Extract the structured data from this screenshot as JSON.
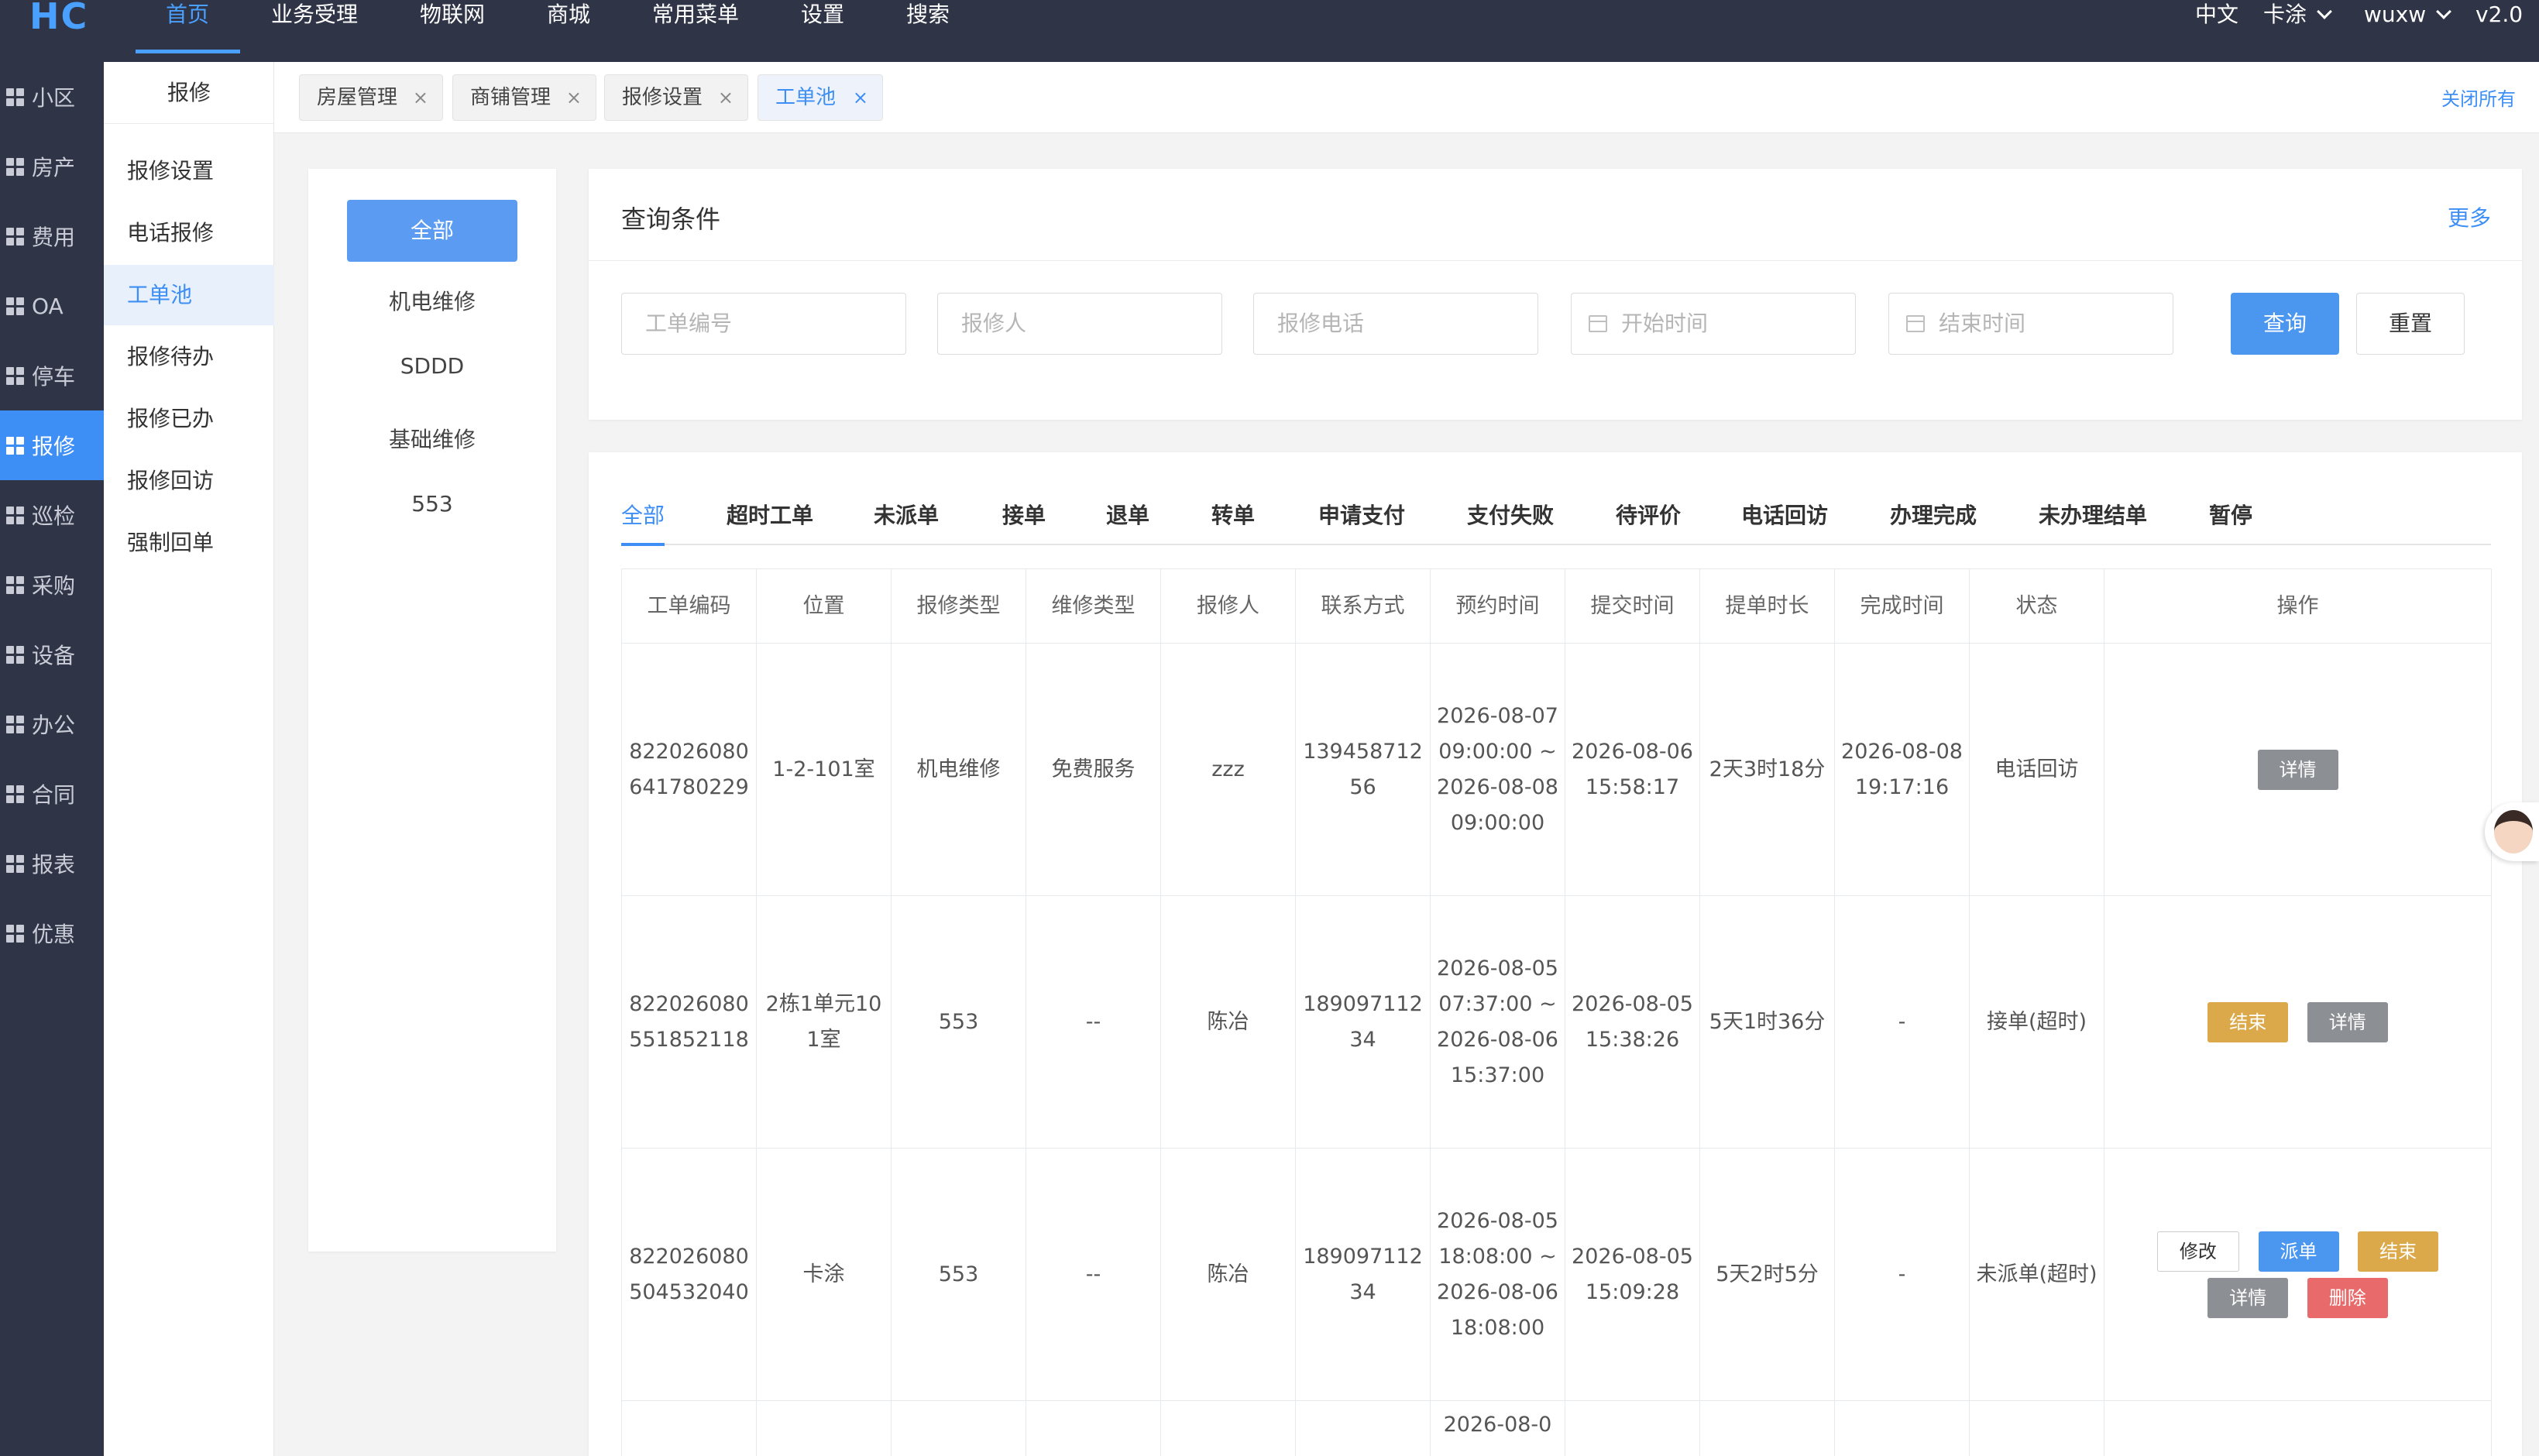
{
  "topbar": {
    "logo": "HC",
    "nav": [
      "首页",
      "业务受理",
      "物联网",
      "商城",
      "常用菜单",
      "设置",
      "搜索"
    ],
    "lang": "中文",
    "community": "卡涂",
    "user": "wuxw",
    "version": "v2.0"
  },
  "sidebar1": {
    "items": [
      "小区",
      "房产",
      "费用",
      "OA",
      "停车",
      "报修",
      "巡检",
      "采购",
      "设备",
      "办公",
      "合同",
      "报表",
      "优惠"
    ]
  },
  "sidebar2": {
    "title": "报修",
    "items": [
      "报修设置",
      "电话报修",
      "工单池",
      "报修待办",
      "报修已办",
      "报修回访",
      "强制回单"
    ]
  },
  "tabs": {
    "items": [
      "房屋管理",
      "商铺管理",
      "报修设置",
      "工单池"
    ],
    "close_all": "关闭所有"
  },
  "categories": {
    "all": "全部",
    "items": [
      "机电维修",
      "SDDD",
      "基础维修",
      "553"
    ]
  },
  "query": {
    "title": "查询条件",
    "more": "更多",
    "order_no_placeholder": "工单编号",
    "reporter_placeholder": "报修人",
    "phone_placeholder": "报修电话",
    "start_placeholder": "开始时间",
    "end_placeholder": "结束时间",
    "search_label": "查询",
    "reset_label": "重置"
  },
  "status_tabs": [
    "全部",
    "超时工单",
    "未派单",
    "接单",
    "退单",
    "转单",
    "申请支付",
    "支付失败",
    "待评价",
    "电话回访",
    "办理完成",
    "未办理结单",
    "暂停"
  ],
  "table": {
    "headers": [
      "工单编码",
      "位置",
      "报修类型",
      "维修类型",
      "报修人",
      "联系方式",
      "预约时间",
      "提交时间",
      "提单时长",
      "完成时间",
      "状态",
      "操作"
    ],
    "rows": [
      {
        "code": "822026080641780229",
        "location": "1-2-101室",
        "repair_type": "机电维修",
        "maint_type": "免费服务",
        "reporter": "zzz",
        "phone": "13945871256",
        "appointment": "2026-08-07 09:00:00 ~2026-08-08 09:00:00",
        "submit_time": "2026-08-06 15:58:17",
        "duration": "2天3时18分",
        "finish_time": "2026-08-08 19:17:16",
        "status": "电话回访",
        "actions": [
          "详情"
        ]
      },
      {
        "code": "822026080551852118",
        "location": "2栋1单元101室",
        "repair_type": "553",
        "maint_type": "--",
        "reporter": "陈冶",
        "phone": "18909711234",
        "appointment": "2026-08-05 07:37:00 ~2026-08-06 15:37:00",
        "submit_time": "2026-08-05 15:38:26",
        "duration": "5天1时36分",
        "finish_time": "-",
        "status": "接单(超时)",
        "actions": [
          "结束",
          "详情"
        ]
      },
      {
        "code": "822026080504532040",
        "location": "卡涂",
        "repair_type": "553",
        "maint_type": "--",
        "reporter": "陈冶",
        "phone": "18909711234",
        "appointment": "2026-08-05 18:08:00 ~2026-08-06 18:08:00",
        "submit_time": "2026-08-05 15:09:28",
        "duration": "5天2时5分",
        "finish_time": "-",
        "status": "未派单(超时)",
        "actions": [
          "修改",
          "派单",
          "结束",
          "详情",
          "删除"
        ]
      },
      {
        "appointment_partial": "2026-08-0"
      }
    ]
  },
  "colors": {
    "primary": "#3d8ef5",
    "topbar": "#2f3447",
    "orange": "#dca94a",
    "gray": "#8c8f93",
    "red": "#e96a6a"
  }
}
